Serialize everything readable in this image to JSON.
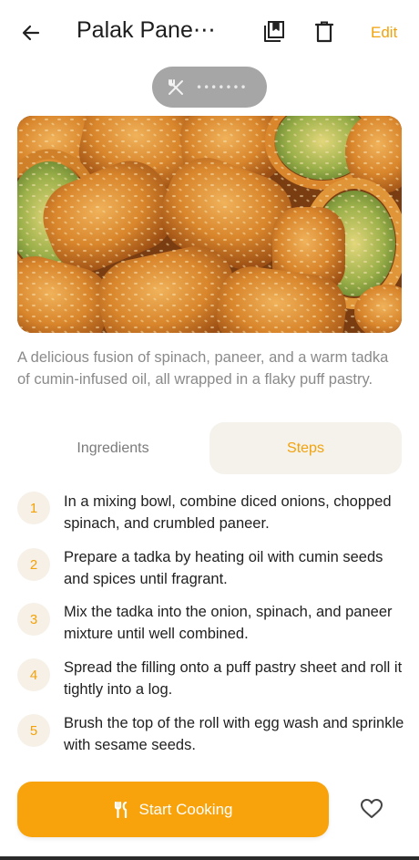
{
  "header": {
    "title": "Palak Pane⋯",
    "edit_label": "Edit"
  },
  "pill": {
    "dots": "•••••••"
  },
  "description": "A delicious fusion of spinach, paneer, and a warm tadka of cumin-infused oil, all wrapped in a flaky puff pastry.",
  "tabs": [
    {
      "label": "Ingredients",
      "active": false
    },
    {
      "label": "Steps",
      "active": true
    }
  ],
  "steps": [
    {
      "number": "1",
      "text": "In a mixing bowl, combine diced onions, chopped spinach, and crumbled paneer."
    },
    {
      "number": "2",
      "text": "Prepare a tadka by heating oil with cumin seeds and spices until fragrant."
    },
    {
      "number": "3",
      "text": "Mix the tadka into the onion, spinach, and paneer mixture until well combined."
    },
    {
      "number": "4",
      "text": "Spread the filling onto a puff pastry sheet and roll it tightly into a log."
    },
    {
      "number": "5",
      "text": "Brush the top of the roll with egg wash and sprinkle with sesame seeds."
    }
  ],
  "footer": {
    "start_label": "Start Cooking"
  },
  "icons": {
    "back": "arrow-left-icon",
    "bookmark": "bookmark-icon",
    "delete": "trash-icon",
    "pill": "fork-knife-icon",
    "start": "fork-knife-icon",
    "favorite": "heart-icon"
  },
  "colors": {
    "accent": "#f9a30c",
    "accent_text": "#f2a20c",
    "step_badge_bg": "#f6f0e6",
    "active_tab_bg": "#f5f2ec",
    "pill_bg": "#a6a6a6",
    "muted_text": "#8a8a8a"
  }
}
